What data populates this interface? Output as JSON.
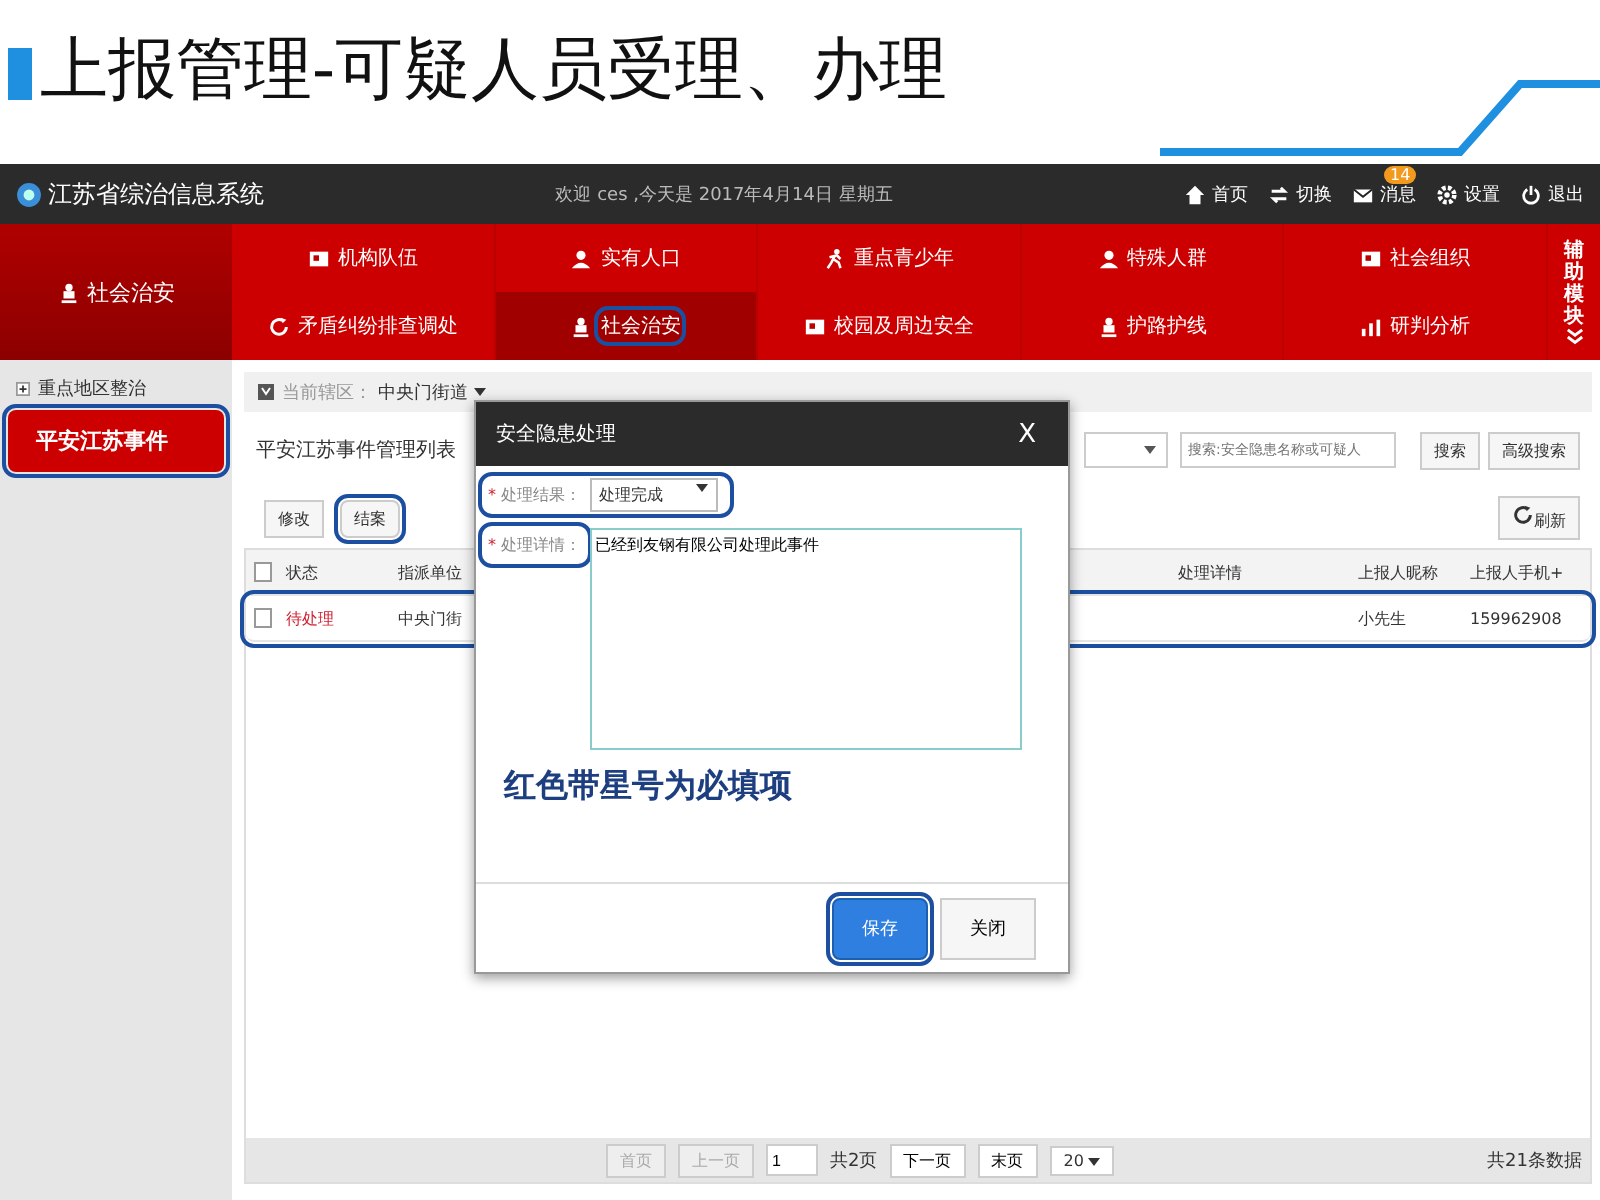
{
  "slide": {
    "title": "上报管理-可疑人员受理、办理"
  },
  "app": {
    "title": "江苏省综治信息系统",
    "welcome": "欢迎 ces ,今天是 2017年4月14日 星期五",
    "top_links": [
      {
        "label": "首页",
        "kind": "home"
      },
      {
        "label": "切换",
        "kind": "switch"
      },
      {
        "label": "消息",
        "kind": "mail",
        "badge": "14"
      },
      {
        "label": "设置",
        "kind": "gear"
      },
      {
        "label": "退出",
        "kind": "power"
      }
    ]
  },
  "module": {
    "label": "社会治安"
  },
  "nav": [
    {
      "label": "机构队伍",
      "kind": "org",
      "selected": false,
      "annotated": false
    },
    {
      "label": "实有人口",
      "kind": "person",
      "selected": false,
      "annotated": false
    },
    {
      "label": "重点青少年",
      "kind": "run",
      "selected": false,
      "annotated": false
    },
    {
      "label": "特殊人群",
      "kind": "person",
      "selected": false,
      "annotated": false
    },
    {
      "label": "社会组织",
      "kind": "org",
      "selected": false,
      "annotated": false
    },
    {
      "label": "矛盾纠纷排查调处",
      "kind": "refresh",
      "selected": false,
      "annotated": false
    },
    {
      "label": "社会治安",
      "kind": "guard",
      "selected": true,
      "annotated": true
    },
    {
      "label": "校园及周边安全",
      "kind": "org",
      "selected": false,
      "annotated": false
    },
    {
      "label": "护路护线",
      "kind": "guard",
      "selected": false,
      "annotated": false
    },
    {
      "label": "研判分析",
      "kind": "chart",
      "selected": false,
      "annotated": false
    }
  ],
  "aux": {
    "label": "辅助模块"
  },
  "sidebar": {
    "items": [
      {
        "label": "重点地区整治",
        "kind": "group",
        "selected": false,
        "annotated": false
      },
      {
        "label": "平安江苏事件",
        "kind": "leaf",
        "selected": true,
        "annotated": true
      }
    ]
  },
  "breadcrumb": {
    "label": "当前辖区：",
    "value": "中央门街道"
  },
  "list": {
    "title": "平安江苏事件管理列表",
    "search": {
      "placeholder": "搜索:安全隐患名称或可疑人"
    },
    "search_button": "搜索",
    "advanced_button": "高级搜索",
    "actions": [
      {
        "label": "修改",
        "annotated": false
      },
      {
        "label": "结案",
        "annotated": true
      }
    ],
    "refresh": "刷新"
  },
  "table": {
    "select_all": {
      "checked": false
    },
    "columns": [
      {
        "label": "状态"
      },
      {
        "label": "指派单位"
      },
      {
        "label": "处理详情"
      },
      {
        "label": "上报人昵称"
      },
      {
        "label": "上报人手机+"
      }
    ],
    "rows": [
      {
        "checked": false,
        "annotated": true,
        "status": "待处理",
        "unit": "中央门街",
        "nickname": "小先生",
        "phone": "159962908"
      }
    ]
  },
  "pagination": {
    "buttons": [
      {
        "label": "首页",
        "disabled": true
      },
      {
        "label": "上一页",
        "disabled": true
      }
    ],
    "page": "1",
    "total_pages": "共2页",
    "next_buttons": [
      {
        "label": "下一页",
        "disabled": false
      },
      {
        "label": "末页",
        "disabled": false
      }
    ],
    "page_size": "20",
    "total": "共21条数据"
  },
  "modal": {
    "title": "安全隐患处理",
    "close": "X",
    "fields": [
      {
        "required_mark": "*",
        "label": "处理结果：",
        "kind": "select",
        "value": "处理完成",
        "annotated": true
      },
      {
        "required_mark": "*",
        "label": "处理详情：",
        "kind": "textarea",
        "value": "已经到友钢有限公司处理此事件",
        "annotated": true
      }
    ],
    "note": "红色带星号为必填项",
    "buttons": [
      {
        "label": "保存",
        "primary": true,
        "annotated": true
      },
      {
        "label": "关闭",
        "primary": false,
        "annotated": false
      }
    ]
  }
}
